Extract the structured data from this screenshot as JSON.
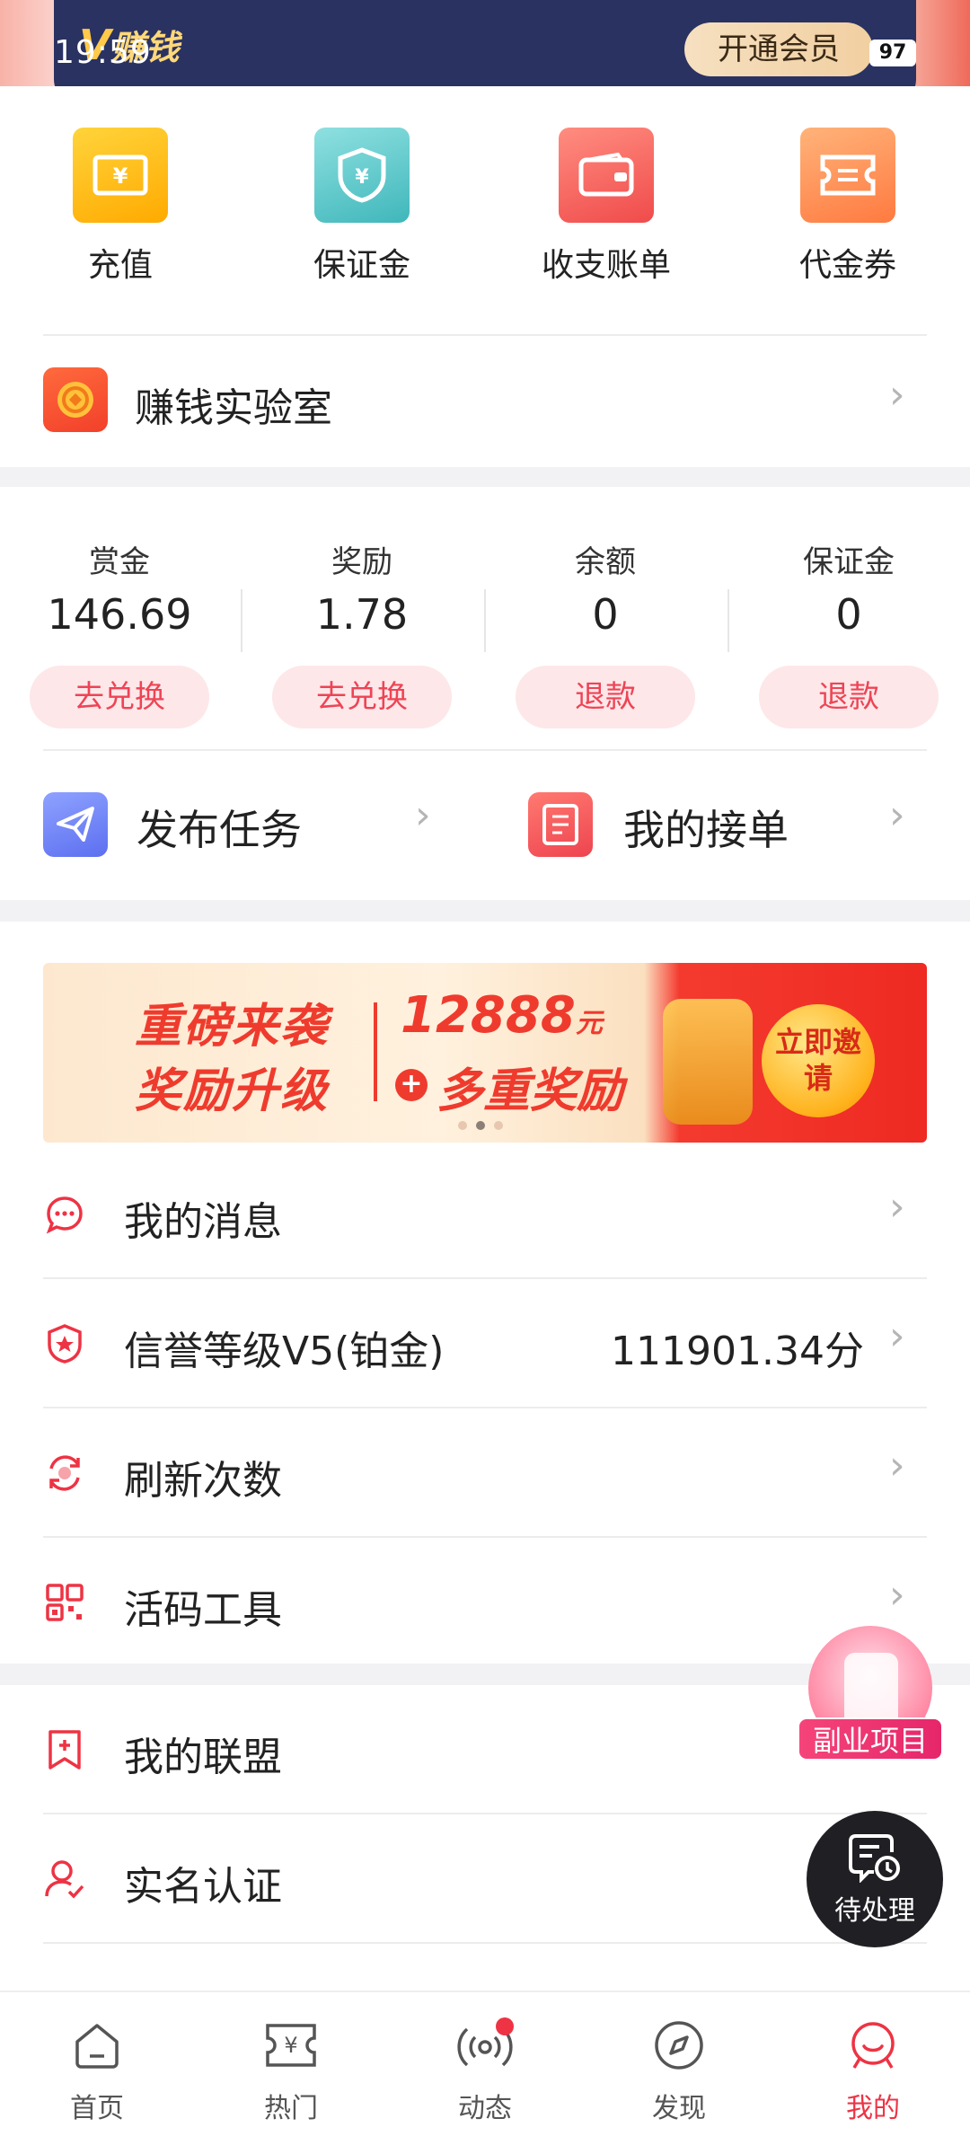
{
  "status_bar": {
    "time": "19:59",
    "battery": "97"
  },
  "vip_bar": {
    "logo_text": "赚钱",
    "logo_mark": "V",
    "open_member_label": "开通会员"
  },
  "quick_actions": [
    {
      "label": "充值",
      "icon": "recharge-ticket-icon"
    },
    {
      "label": "保证金",
      "icon": "shield-yuan-icon"
    },
    {
      "label": "收支账单",
      "icon": "wallet-icon"
    },
    {
      "label": "代金券",
      "icon": "coupon-icon"
    }
  ],
  "lab": {
    "label": "赚钱实验室",
    "icon": "coin-icon"
  },
  "balances": [
    {
      "title": "赏金",
      "value": "146.69",
      "action": "去兑换"
    },
    {
      "title": "奖励",
      "value": "1.78",
      "action": "去兑换"
    },
    {
      "title": "余额",
      "value": "0",
      "action": "退款"
    },
    {
      "title": "保证金",
      "value": "0",
      "action": "退款"
    }
  ],
  "task_row": {
    "publish_label": "发布任务",
    "orders_label": "我的接单"
  },
  "banner": {
    "line1": "重磅来袭",
    "line2": "奖励升级",
    "amount": "12888",
    "unit": "元",
    "plus": "+",
    "line3": "多重奖励",
    "cta": "立即邀请"
  },
  "menu": [
    {
      "label": "我的消息",
      "value": "",
      "icon": "message-icon"
    },
    {
      "label": "信誉等级V5(铂金)",
      "value": "111901.34分",
      "icon": "credit-shield-icon"
    },
    {
      "label": "刷新次数",
      "value": "",
      "icon": "refresh-icon"
    },
    {
      "label": "活码工具",
      "value": "",
      "icon": "qrcode-icon"
    }
  ],
  "menu2": [
    {
      "label": "我的联盟",
      "icon": "bookmark-plus-icon"
    },
    {
      "label": "实名认证",
      "icon": "user-check-icon"
    }
  ],
  "floating": {
    "side_project": "副业项目",
    "pending": "待处理"
  },
  "tabs": [
    {
      "label": "首页",
      "icon": "home-icon"
    },
    {
      "label": "热门",
      "icon": "hot-ticket-icon"
    },
    {
      "label": "动态",
      "icon": "broadcast-icon"
    },
    {
      "label": "发现",
      "icon": "compass-icon"
    },
    {
      "label": "我的",
      "icon": "profile-icon"
    }
  ],
  "colors": {
    "accent": "#ee3344",
    "vip_bg": "#2a3262",
    "button_tint": "#fde7e9"
  }
}
